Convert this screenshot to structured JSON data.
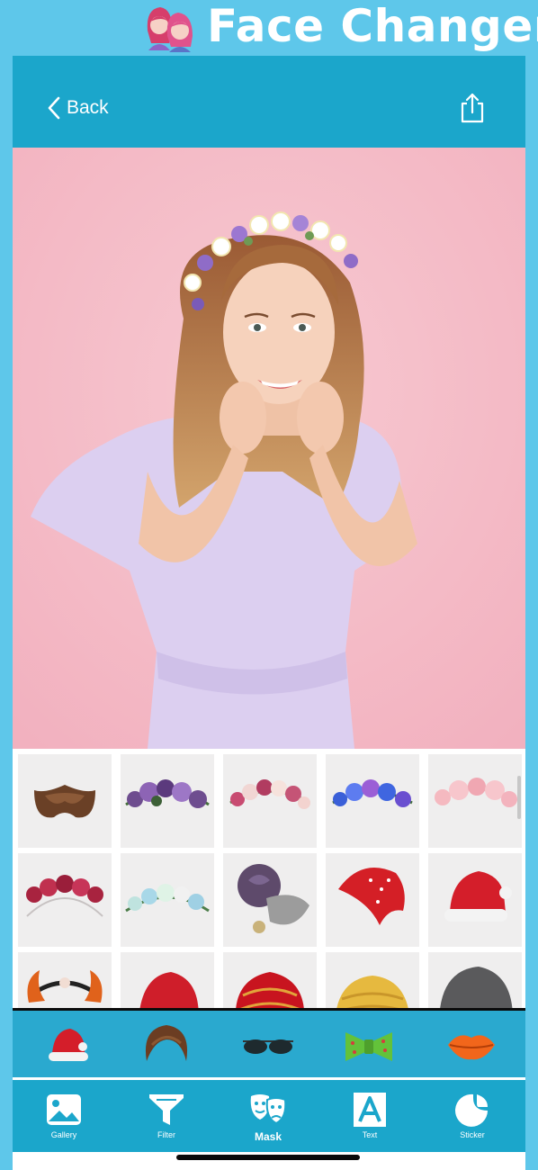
{
  "banner": {
    "title": "Face Changer",
    "logo_icon": "twin-girls-icon"
  },
  "nav": {
    "back_label": "Back",
    "back_icon": "chevron-left-icon",
    "share_icon": "share-icon"
  },
  "photo": {
    "subject": "woman-with-flower-crown",
    "background_color": "#f6c2cc"
  },
  "stickers": [
    {
      "name": "mustache-sticker"
    },
    {
      "name": "purple-flower-crown-sticker"
    },
    {
      "name": "pink-flower-crown-sticker"
    },
    {
      "name": "blue-flower-crown-sticker"
    },
    {
      "name": "peach-flower-crown-sticker"
    },
    {
      "name": "red-flower-crown-sticker"
    },
    {
      "name": "pastel-flower-crown-sticker"
    },
    {
      "name": "rose-feather-sticker"
    },
    {
      "name": "red-bandana-sticker"
    },
    {
      "name": "santa-hat-sticker"
    },
    {
      "name": "devil-horns-sticker"
    },
    {
      "name": "santa-hat-sticker"
    },
    {
      "name": "red-turban-sticker"
    },
    {
      "name": "yellow-turban-sticker"
    },
    {
      "name": "beanie-sticker"
    }
  ],
  "categories": [
    {
      "name": "santa-hat-icon"
    },
    {
      "name": "hair-icon"
    },
    {
      "name": "sunglasses-icon"
    },
    {
      "name": "bow-tie-icon"
    },
    {
      "name": "lips-icon"
    }
  ],
  "tabs": [
    {
      "label": "Gallery",
      "icon": "gallery-icon"
    },
    {
      "label": "Filter",
      "icon": "filter-icon"
    },
    {
      "label": "Mask",
      "icon": "mask-icon",
      "active": true
    },
    {
      "label": "Text",
      "icon": "text-icon"
    },
    {
      "label": "Sticker",
      "icon": "sticker-icon"
    }
  ],
  "colors": {
    "brand": "#5ec7ea",
    "nav": "#1ba6cb",
    "strip": "#2aa9cf"
  }
}
